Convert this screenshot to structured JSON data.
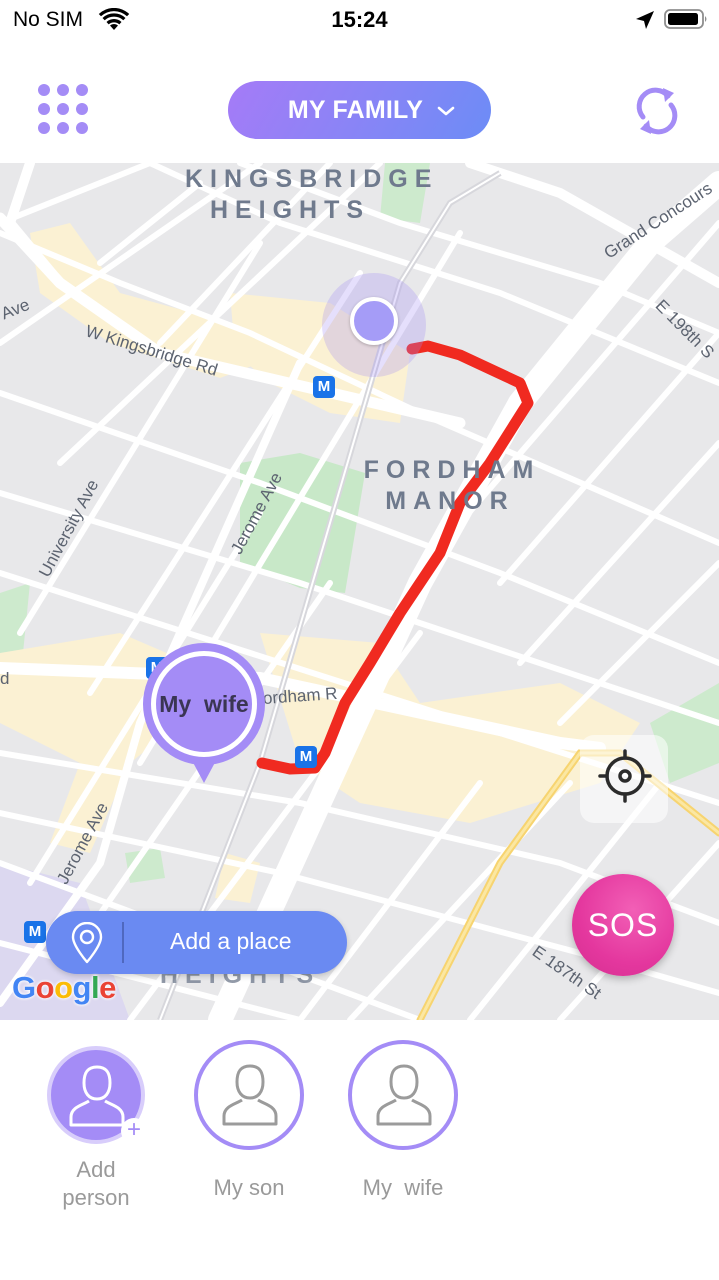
{
  "status_bar": {
    "carrier": "No SIM",
    "time": "15:24",
    "icons": [
      "wifi-icon",
      "location-arrow-icon",
      "battery-icon"
    ]
  },
  "header": {
    "menu_icon": "grid-menu-icon",
    "group_selector": "MY FAMILY",
    "group_selector_icon": "chevron-down-icon",
    "refresh_icon": "refresh-icon"
  },
  "map": {
    "area_labels": [
      "KINGSBRIDGE",
      "HEIGHTS",
      "FORDHAM",
      "MANOR",
      "HEIGHTS"
    ],
    "streets": {
      "w_kingsbridge": "W Kingsbridge Rd",
      "ave_top_left": "Ave",
      "university": "University Ave",
      "jerome_top": "Jerome Ave",
      "jerome_bottom": "Jerome Ave",
      "grand_concourse": "Grand Concours",
      "e198": "E 198th S",
      "fordham_rd": "ordham R",
      "e187": "E 187th St",
      "left_edge": "d"
    },
    "metro_label": "M",
    "my_location_marker": "current-location-dot",
    "member_pin_label": "My  wife",
    "route_color": "#f02a20",
    "locate_icon": "crosshair-icon",
    "sos_label": "SOS",
    "add_place_label": "Add a place",
    "add_place_icon": "map-pin-icon",
    "attribution": "Google"
  },
  "people": [
    {
      "name": "Add\nperson",
      "type": "add",
      "icon": "add-person-icon"
    },
    {
      "name": "My son",
      "type": "member",
      "icon": "person-icon"
    },
    {
      "name": "My  wife",
      "type": "member",
      "icon": "person-icon"
    }
  ],
  "colors": {
    "accent": "#a48cf6",
    "accent_blue": "#6a8af2",
    "sos": "#e4379e",
    "route": "#f02a20",
    "text_muted": "#9a9a9a"
  }
}
